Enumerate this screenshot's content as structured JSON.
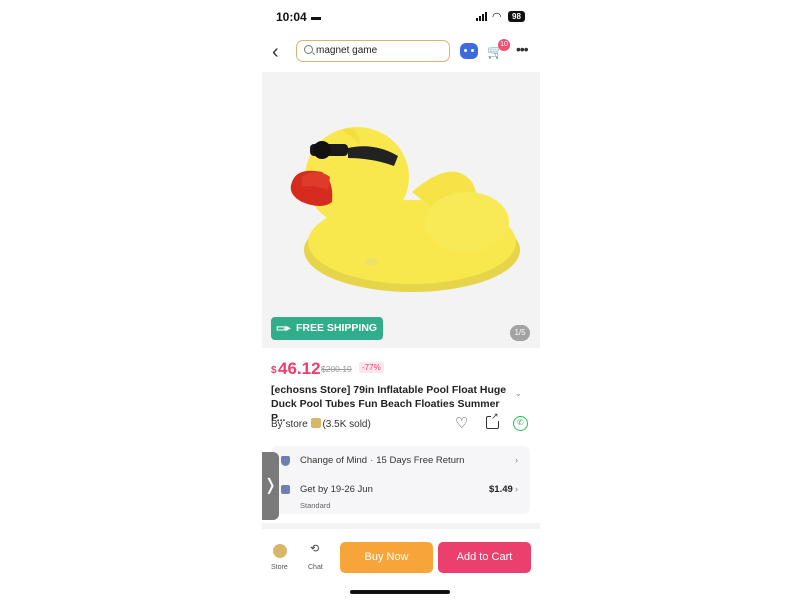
{
  "status_bar": {
    "time": "10:04",
    "battery": "98"
  },
  "header": {
    "search_value": "magnet game",
    "cart_badge": "10",
    "back_glyph": "‹",
    "more_glyph": "•••"
  },
  "gallery": {
    "free_shipping": "FREE SHIPPING",
    "pager": "1/5"
  },
  "product": {
    "currency": "$",
    "price": "46.12",
    "original_price": "$200.19",
    "discount": "-77%",
    "title": "[echosns Store] 79in Inflatable Pool Float Huge Duck Pool Tubes Fun Beach Floaties Summer P...",
    "by_store_prefix": "By store",
    "sold": "(3.5K sold)"
  },
  "info": {
    "return_policy": "Change of Mind",
    "return_detail": "15 Days Free Return",
    "delivery": "Get by 19-26 Jun",
    "delivery_method": "Standard",
    "delivery_price": "$1.49"
  },
  "bottom_bar": {
    "store_label": "Store",
    "chat_label": "Chat",
    "buy_now": "Buy Now",
    "add_to_cart": "Add to Cart"
  },
  "colors": {
    "accent": "#f03c6e",
    "buy_now": "#f7a53b",
    "add_to_cart": "#eb3f6d",
    "free_shipping": "#30ad8a"
  }
}
